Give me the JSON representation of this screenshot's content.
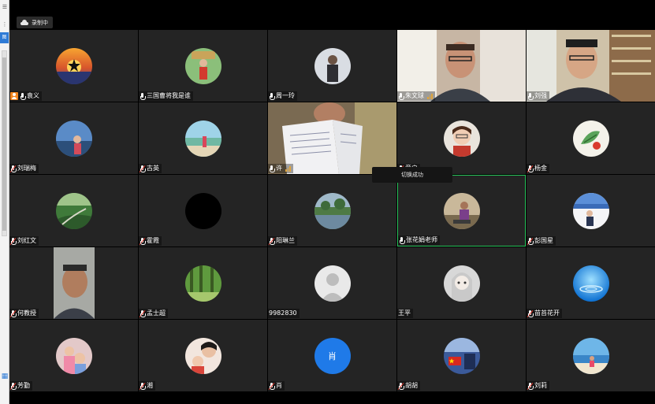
{
  "recording": {
    "label": "录制中"
  },
  "toast": {
    "text": "切换成功"
  },
  "participants": [
    {
      "name": "袁义",
      "kind": "avatar",
      "host": true,
      "mic": "on"
    },
    {
      "name": "三国曹将我是谁",
      "kind": "avatar",
      "mic": "on"
    },
    {
      "name": "周一玲",
      "kind": "avatar",
      "mic": "muted"
    },
    {
      "name": "朱文球",
      "kind": "video",
      "mic": "on",
      "signal": true
    },
    {
      "name": "刘强",
      "kind": "video",
      "mic": "on"
    },
    {
      "name": "刘瑞梅",
      "kind": "avatar",
      "mic": "muted"
    },
    {
      "name": "古英",
      "kind": "avatar",
      "mic": "muted"
    },
    {
      "name": "许",
      "kind": "video",
      "mic": "on",
      "signal": true
    },
    {
      "name": "童启",
      "kind": "avatar",
      "mic": "muted"
    },
    {
      "name": "杨金",
      "kind": "avatar",
      "mic": "muted"
    },
    {
      "name": "刘红文",
      "kind": "avatar",
      "mic": "muted"
    },
    {
      "name": "霍霞",
      "kind": "avatar",
      "mic": "muted"
    },
    {
      "name": "阳琳兰",
      "kind": "avatar",
      "mic": "muted"
    },
    {
      "name": "张花娟老师",
      "kind": "avatar",
      "mic": "on",
      "active": true
    },
    {
      "name": "彭国星",
      "kind": "avatar",
      "mic": "muted"
    },
    {
      "name": "何教授",
      "kind": "video",
      "mic": "muted"
    },
    {
      "name": "孟士超",
      "kind": "avatar",
      "mic": "muted"
    },
    {
      "name": "9982830",
      "kind": "avatar",
      "mic": "none"
    },
    {
      "name": "王平",
      "kind": "avatar",
      "mic": "none"
    },
    {
      "name": "苗苔花开",
      "kind": "avatar",
      "mic": "muted"
    },
    {
      "name": "芳勤",
      "kind": "avatar",
      "mic": "muted"
    },
    {
      "name": "湘",
      "kind": "avatar",
      "mic": "muted"
    },
    {
      "name": "肖",
      "kind": "avatar",
      "mic": "muted",
      "avatar_letter": "肖"
    },
    {
      "name": "胡胡",
      "kind": "avatar",
      "mic": "muted"
    },
    {
      "name": "刘莉",
      "kind": "avatar",
      "mic": "muted"
    }
  ],
  "colors": {
    "tile_bg": "#242424",
    "active_border": "#27c35a",
    "host_badge": "#f2861f",
    "letter_avatar": "#1f7ae8"
  }
}
